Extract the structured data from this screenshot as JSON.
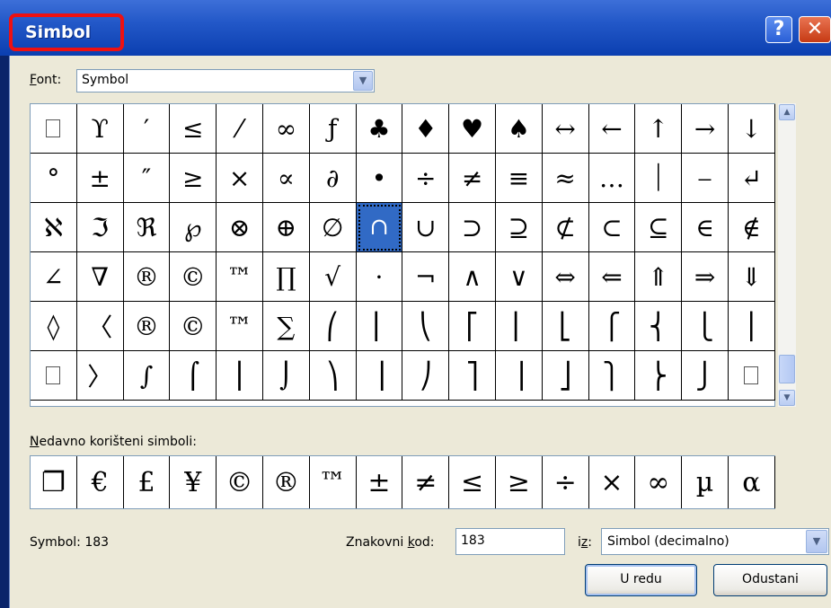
{
  "dialog": {
    "title": "Simbol",
    "help": "?",
    "close": "✕"
  },
  "font": {
    "label_u": "F",
    "label_rest": "ont:",
    "value": "Symbol"
  },
  "grid": {
    "selected_index": 39,
    "rows": [
      [
        "",
        "ϒ",
        "′",
        "≤",
        "⁄",
        "∞",
        "ƒ",
        "♣",
        "♦",
        "♥",
        "♠",
        "↔",
        "←",
        "↑",
        "→",
        "↓"
      ],
      [
        "°",
        "±",
        "″",
        "≥",
        "×",
        "∝",
        "∂",
        "•",
        "÷",
        "≠",
        "≡",
        "≈",
        "…",
        "⏐",
        "⎯",
        "↵"
      ],
      [
        "ℵ",
        "ℑ",
        "ℜ",
        "℘",
        "⊗",
        "⊕",
        "∅",
        "∩",
        "∪",
        "⊃",
        "⊇",
        "⊄",
        "⊂",
        "⊆",
        "∈",
        "∉"
      ],
      [
        "∠",
        "∇",
        "®",
        "©",
        "™",
        "∏",
        "√",
        "⋅",
        "¬",
        "∧",
        "∨",
        "⇔",
        "⇐",
        "⇑",
        "⇒",
        "⇓"
      ],
      [
        "◊",
        "〈",
        "®",
        "©",
        "™",
        "∑",
        "⎛",
        "⎜",
        "⎝",
        "⎡",
        "⎢",
        "⎣",
        "⎧",
        "⎨",
        "⎩",
        "⎪"
      ],
      [
        "",
        "〉",
        "∫",
        "⌠",
        "⎮",
        "⌡",
        "⎞",
        "⎟",
        "⎠",
        "⎤",
        "⎥",
        "⎦",
        "⎫",
        "⎬",
        "⎭",
        ""
      ]
    ]
  },
  "recent": {
    "label_u": "N",
    "label_rest": "edavno korišteni simboli:",
    "symbols": [
      "❐",
      "€",
      "£",
      "¥",
      "©",
      "®",
      "™",
      "±",
      "≠",
      "≤",
      "≥",
      "÷",
      "×",
      "∞",
      "µ",
      "α"
    ]
  },
  "status": {
    "symbol_text": "Symbol: 183"
  },
  "code": {
    "label_a": "Znakovni ",
    "label_u": "k",
    "label_b": "od:",
    "value": "183"
  },
  "from": {
    "label_a": "i",
    "label_u": "z",
    "label_b": ":",
    "value": "Simbol (decimalno)"
  },
  "buttons": {
    "ok": "U redu",
    "cancel": "Odustani"
  },
  "colors": {
    "titlebar": "#2358c8",
    "highlight": "#ee1111",
    "selection": "#316ac5"
  }
}
